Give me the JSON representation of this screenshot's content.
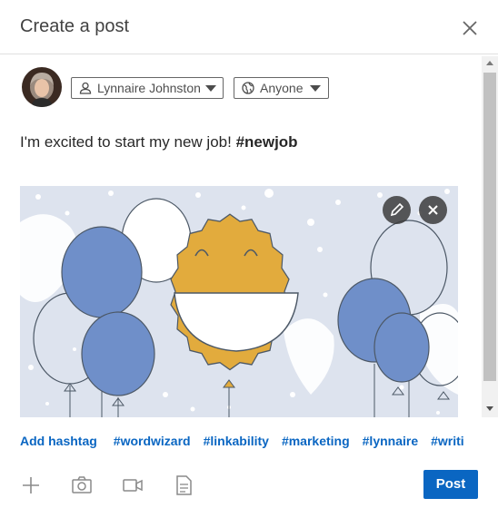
{
  "dialog": {
    "title": "Create a post"
  },
  "author": {
    "name": "Lynnaire Johnston",
    "visibility": "Anyone"
  },
  "post": {
    "text": "I'm excited to start my new job! ",
    "hashtag": "#newjob"
  },
  "hashtags": {
    "add_label": "Add hashtag",
    "suggestions": [
      "#wordwizard",
      "#linkability",
      "#marketing",
      "#lynnaire",
      "#writi"
    ]
  },
  "footer": {
    "post_label": "Post"
  },
  "icons": [
    "close-icon",
    "person-icon",
    "globe-icon",
    "pencil-icon",
    "x-icon",
    "plus-icon",
    "camera-icon",
    "video-icon",
    "document-icon"
  ],
  "colors": {
    "accent": "#0a66c2",
    "balloon_blue": "#6f8fc9",
    "sun_yellow": "#e2ab3d",
    "image_background": "#dde3ee"
  }
}
